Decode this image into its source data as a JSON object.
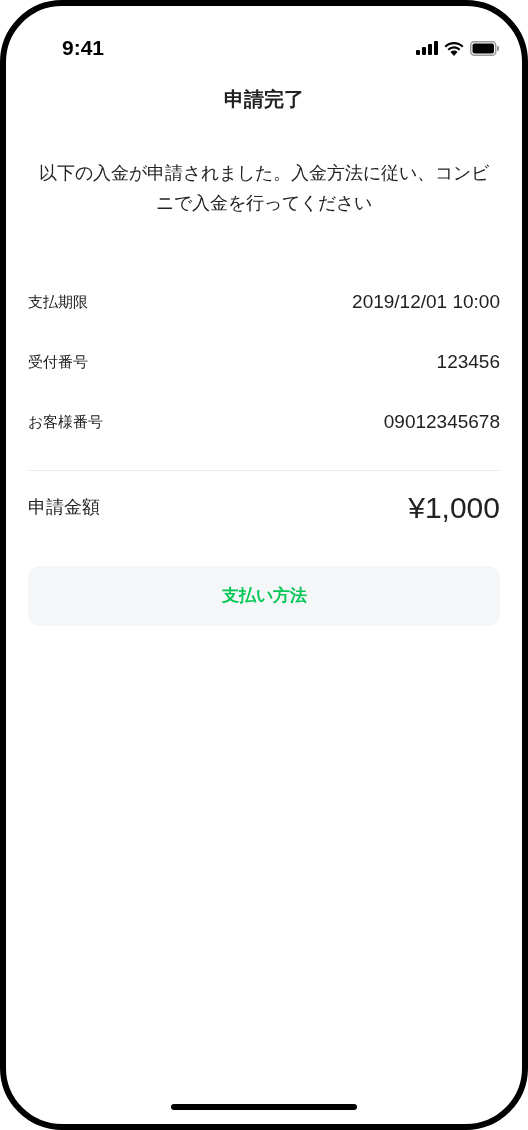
{
  "status_bar": {
    "time": "9:41"
  },
  "title": "申請完了",
  "message": "以下の入金が申請されました。入金方法に従い、コンビニで入金を行ってください",
  "details": [
    {
      "label": "支払期限",
      "value": "2019/12/01 10:00"
    },
    {
      "label": "受付番号",
      "value": "123456"
    },
    {
      "label": "お客様番号",
      "value": "09012345678"
    }
  ],
  "total": {
    "label": "申請金額",
    "amount": "¥1,000"
  },
  "button": {
    "label": "支払い方法"
  }
}
